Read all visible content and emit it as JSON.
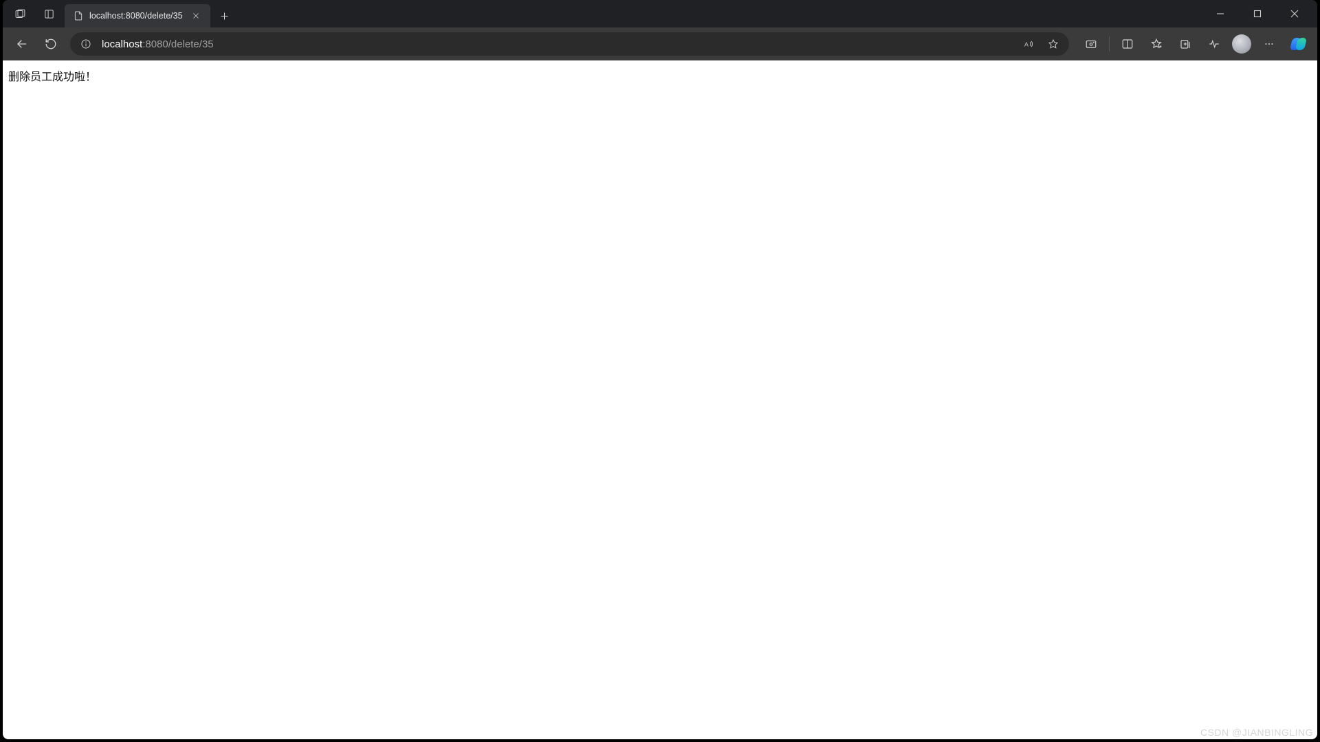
{
  "window": {
    "title": "localhost:8080/delete/35"
  },
  "tab": {
    "title": "localhost:8080/delete/35"
  },
  "address": {
    "host": "localhost",
    "rest": ":8080/delete/35"
  },
  "page": {
    "message": "删除员工成功啦！"
  },
  "watermark": "CSDN @JIANBINGLING"
}
